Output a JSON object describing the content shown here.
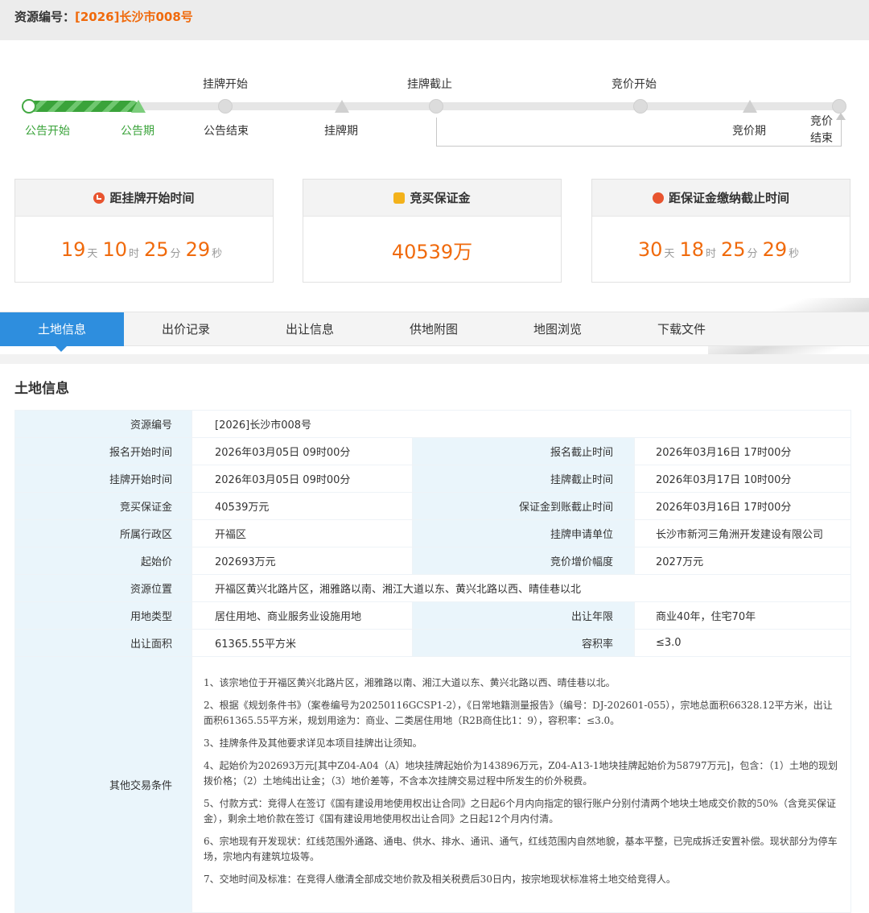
{
  "header": {
    "label": "资源编号：",
    "value": "[2026]长沙市008号"
  },
  "timeline": {
    "top_labels": [
      "挂牌开始",
      "挂牌截止",
      "竞价开始"
    ],
    "bottom_labels": [
      "公告开始",
      "公告期",
      "公告结束",
      "挂牌期",
      "竞价期",
      "竞价",
      "结束"
    ]
  },
  "cards": [
    {
      "title": "距挂牌开始时间",
      "icon": "clock-icon",
      "d": "19",
      "d_unit": "天",
      "h": "10",
      "h_unit": "时",
      "m": "25",
      "m_unit": "分",
      "s": "29",
      "s_unit": "秒"
    },
    {
      "title": "竞买保证金",
      "icon": "coin-icon",
      "value": "40539万"
    },
    {
      "title": "距保证金缴纳截止时间",
      "icon": "alarm-icon",
      "d": "30",
      "d_unit": "天",
      "h": "18",
      "h_unit": "时",
      "m": "25",
      "m_unit": "分",
      "s": "29",
      "s_unit": "秒"
    }
  ],
  "tabs": [
    "土地信息",
    "出价记录",
    "出让信息",
    "供地附图",
    "地图浏览",
    "下载文件"
  ],
  "section_title": "土地信息",
  "info": {
    "row1": {
      "k": "资源编号",
      "v": "[2026]长沙市008号"
    },
    "row2": {
      "k1": "报名开始时间",
      "v1": "2026年03月05日 09时00分",
      "k2": "报名截止时间",
      "v2": "2026年03月16日 17时00分"
    },
    "row3": {
      "k1": "挂牌开始时间",
      "v1": "2026年03月05日 09时00分",
      "k2": "挂牌截止时间",
      "v2": "2026年03月17日 10时00分"
    },
    "row4": {
      "k1": "竞买保证金",
      "v1": "40539万元",
      "k2": "保证金到账截止时间",
      "v2": "2026年03月16日 17时00分"
    },
    "row5": {
      "k1": "所属行政区",
      "v1": "开福区",
      "k2": "挂牌申请单位",
      "v2": "长沙市新河三角洲开发建设有限公司"
    },
    "row6": {
      "k1": "起始价",
      "v1": "202693万元",
      "k2": "竞价增价幅度",
      "v2": "2027万元"
    },
    "row7": {
      "k": "资源位置",
      "v": "开福区黄兴北路片区，湘雅路以南、湘江大道以东、黄兴北路以西、晴佳巷以北"
    },
    "row8": {
      "k1": "用地类型",
      "v1": "居住用地、商业服务业设施用地",
      "k2": "出让年限",
      "v2": "商业40年，住宅70年"
    },
    "row9": {
      "k1": "出让面积",
      "v1": "61365.55平方米",
      "k2": "容积率",
      "v2": "≤3.0"
    },
    "terms_label": "其他交易条件",
    "terms": [
      "1、该宗地位于开福区黄兴北路片区，湘雅路以南、湘江大道以东、黄兴北路以西、晴佳巷以北。",
      "2、根据《规划条件书》（案卷编号为20250116GCSP1-2），《日常地籍测量报告》（编号：DJ-202601-055），宗地总面积66328.12平方米，出让面积61365.55平方米，规划用途为：商业、二类居住用地（R2B商住比1：9），容积率：≤3.0。",
      "3、挂牌条件及其他要求详见本项目挂牌出让须知。",
      "4、起始价为202693万元[其中Z04-A04（A）地块挂牌起始价为143896万元，Z04-A13-1地块挂牌起始价为58797万元]，包含：（1）土地的现划拨价格；（2）土地纯出让金；（3）地价差等，不含本次挂牌交易过程中所发生的价外税费。",
      "5、付款方式：竞得人在签订《国有建设用地使用权出让合同》之日起6个月内向指定的银行账户分别付清两个地块土地成交价款的50%（含竞买保证金），剩余土地价款在签订《国有建设用地使用权出让合同》之日起12个月内付清。",
      "6、宗地现有开发现状：红线范围外通路、通电、供水、排水、通讯、通气，红线范围内自然地貌，基本平整，已完成拆迁安置补偿。现状部分为停车场，宗地内有建筑垃圾等。",
      "7、交地时间及标准：在竞得人缴清全部成交地价款及相关税费后30日内，按宗地现状标准将土地交给竞得人。"
    ]
  }
}
